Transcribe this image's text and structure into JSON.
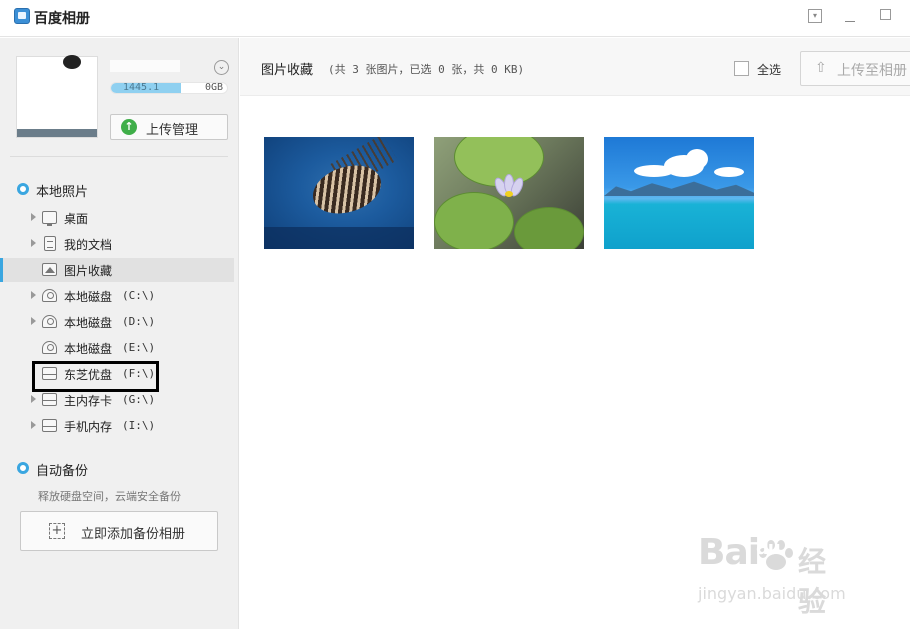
{
  "window": {
    "title": "百度相册",
    "menu_icon": "menu-icon",
    "minimize_icon": "minimize-icon",
    "maximize_icon": "maximize-icon"
  },
  "user": {
    "storage_used": "1445.1",
    "storage_total": "0GB",
    "storage_fraction": 0.6,
    "upload_manager_label": "上传管理"
  },
  "sidebar": {
    "local_photos_title": "本地照片",
    "items": [
      {
        "name": "桌面",
        "drive": "",
        "icon": "monitor-icon",
        "has_arrow": true
      },
      {
        "name": "我的文档",
        "drive": "",
        "icon": "document-icon",
        "has_arrow": true
      },
      {
        "name": "图片收藏",
        "drive": "",
        "icon": "image-icon",
        "has_arrow": false,
        "selected": true
      },
      {
        "name": "本地磁盘",
        "drive": "(C:\\)",
        "icon": "disk-icon",
        "has_arrow": true
      },
      {
        "name": "本地磁盘",
        "drive": "(D:\\)",
        "icon": "disk-icon",
        "has_arrow": true
      },
      {
        "name": "本地磁盘",
        "drive": "(E:\\)",
        "icon": "disk-icon",
        "has_arrow": false
      },
      {
        "name": "东芝优盘",
        "drive": "(F:\\)",
        "icon": "usb-drive-icon",
        "has_arrow": false,
        "highlighted": true
      },
      {
        "name": "主内存卡",
        "drive": "(G:\\)",
        "icon": "usb-drive-icon",
        "has_arrow": true
      },
      {
        "name": "手机内存",
        "drive": "(I:\\)",
        "icon": "usb-drive-icon",
        "has_arrow": true
      }
    ],
    "auto_backup_title": "自动备份",
    "auto_backup_desc": "释放硬盘空间，云端安全备份",
    "add_backup_label": "立即添加备份相册"
  },
  "main": {
    "title": "图片收藏",
    "info": "(共 3 张图片，已选 0 张，共 0 KB)",
    "select_all_label": "全选",
    "upload_album_label": "上传至相册",
    "photos": [
      {
        "subject": "lionfish",
        "icon": "photo-lionfish"
      },
      {
        "subject": "water lily",
        "icon": "photo-water-lily"
      },
      {
        "subject": "sea and sky",
        "icon": "photo-sea-sky"
      }
    ]
  },
  "watermark": {
    "brand": "Bai",
    "brand_suffix": "du",
    "jingyan": "经验",
    "url": "jingyan.baidu.com"
  },
  "colors": {
    "accent": "#3aa6e0",
    "sidebar_bg": "#f0f0f0",
    "selected_bg": "#e1e1e1",
    "storage_fill": "#8fd0f0",
    "upload_green": "#3fae49"
  }
}
